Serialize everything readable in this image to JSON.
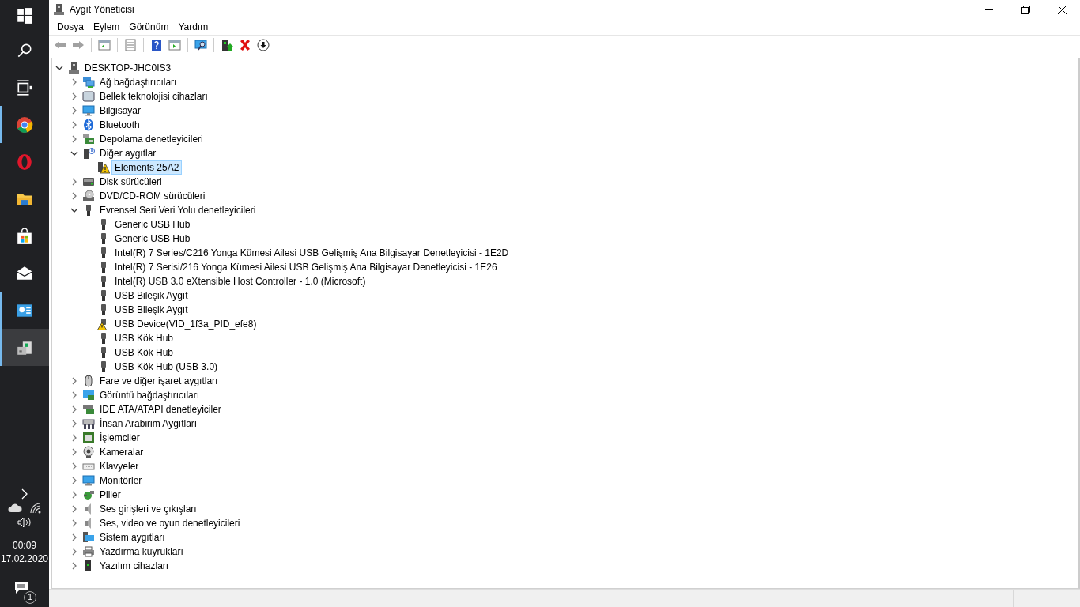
{
  "taskbar": {
    "items": [
      {
        "kind": "start",
        "running": false,
        "active": false
      },
      {
        "kind": "search",
        "running": false,
        "active": false
      },
      {
        "kind": "task-view",
        "running": false,
        "active": false
      },
      {
        "kind": "chrome",
        "running": true,
        "active": false
      },
      {
        "kind": "opera",
        "running": false,
        "active": false
      },
      {
        "kind": "explorer",
        "running": false,
        "active": false
      },
      {
        "kind": "store",
        "running": false,
        "active": false
      },
      {
        "kind": "mail",
        "running": false,
        "active": false
      },
      {
        "kind": "control",
        "running": true,
        "active": false
      },
      {
        "kind": "device-manager",
        "running": true,
        "active": true
      }
    ],
    "clock": {
      "time": "00:09",
      "date": "17.02.2020"
    },
    "notification_count": "1"
  },
  "window": {
    "title": "Aygıt Yöneticisi"
  },
  "menu": [
    "Dosya",
    "Eylem",
    "Görünüm",
    "Yardım"
  ],
  "toolbar": [
    {
      "kind": "back",
      "disabled": true
    },
    {
      "kind": "forward",
      "disabled": true
    },
    {
      "kind": "sep"
    },
    {
      "kind": "console-tree",
      "disabled": false
    },
    {
      "kind": "sep"
    },
    {
      "kind": "properties",
      "disabled": false
    },
    {
      "kind": "sep"
    },
    {
      "kind": "help",
      "disabled": false
    },
    {
      "kind": "action-pane",
      "disabled": false
    },
    {
      "kind": "sep"
    },
    {
      "kind": "scan",
      "disabled": false
    },
    {
      "kind": "sep"
    },
    {
      "kind": "update",
      "disabled": false
    },
    {
      "kind": "uninstall",
      "disabled": false
    },
    {
      "kind": "download",
      "disabled": false
    }
  ],
  "tree": {
    "label": "DESKTOP-JHC0IS3",
    "kind": "pc",
    "expanded": true,
    "selected": false,
    "children": [
      {
        "label": "Ağ bağdaştırıcıları",
        "kind": "network",
        "expanded": false,
        "selected": false
      },
      {
        "label": "Bellek teknolojisi cihazları",
        "kind": "memory",
        "expanded": false,
        "selected": false
      },
      {
        "label": "Bilgisayar",
        "kind": "computer",
        "expanded": false,
        "selected": false
      },
      {
        "label": "Bluetooth",
        "kind": "bluetooth",
        "expanded": false,
        "selected": false
      },
      {
        "label": "Depolama denetleyicileri",
        "kind": "storage",
        "expanded": false,
        "selected": false
      },
      {
        "label": "Diğer aygıtlar",
        "kind": "unknown",
        "expanded": true,
        "selected": false,
        "children": [
          {
            "label": "Elements 25A2",
            "kind": "warning-device",
            "selected": true
          }
        ]
      },
      {
        "label": "Disk sürücüleri",
        "kind": "disk",
        "expanded": false,
        "selected": false
      },
      {
        "label": "DVD/CD-ROM sürücüleri",
        "kind": "dvd",
        "expanded": false,
        "selected": false
      },
      {
        "label": "Evrensel Seri Veri Yolu denetleyicileri",
        "kind": "usb",
        "expanded": true,
        "selected": false,
        "children": [
          {
            "label": "Generic USB Hub",
            "kind": "usb",
            "selected": false
          },
          {
            "label": "Generic USB Hub",
            "kind": "usb",
            "selected": false
          },
          {
            "label": "Intel(R) 7 Series/C216 Yonga Kümesi Ailesi USB Gelişmiş Ana Bilgisayar Denetleyicisi - 1E2D",
            "kind": "usb",
            "selected": false
          },
          {
            "label": "Intel(R) 7 Serisi/216 Yonga Kümesi Ailesi USB Gelişmiş Ana Bilgisayar Denetleyicisi - 1E26",
            "kind": "usb",
            "selected": false
          },
          {
            "label": "Intel(R) USB 3.0 eXtensible Host Controller - 1.0 (Microsoft)",
            "kind": "usb",
            "selected": false
          },
          {
            "label": "USB Bileşik Aygıt",
            "kind": "usb",
            "selected": false
          },
          {
            "label": "USB Bileşik Aygıt",
            "kind": "usb",
            "selected": false
          },
          {
            "label": "USB Device(VID_1f3a_PID_efe8)",
            "kind": "usb-warning",
            "selected": false
          },
          {
            "label": "USB Kök Hub",
            "kind": "usb",
            "selected": false
          },
          {
            "label": "USB Kök Hub",
            "kind": "usb",
            "selected": false
          },
          {
            "label": "USB Kök Hub (USB 3.0)",
            "kind": "usb",
            "selected": false
          }
        ]
      },
      {
        "label": "Fare ve diğer işaret aygıtları",
        "kind": "mouse",
        "expanded": false,
        "selected": false
      },
      {
        "label": "Görüntü bağdaştırıcıları",
        "kind": "display-adapter",
        "expanded": false,
        "selected": false
      },
      {
        "label": "IDE ATA/ATAPI denetleyiciler",
        "kind": "ide",
        "expanded": false,
        "selected": false
      },
      {
        "label": "İnsan Arabirim Aygıtları",
        "kind": "hid",
        "expanded": false,
        "selected": false
      },
      {
        "label": "İşlemciler",
        "kind": "cpu",
        "expanded": false,
        "selected": false
      },
      {
        "label": "Kameralar",
        "kind": "camera",
        "expanded": false,
        "selected": false
      },
      {
        "label": "Klavyeler",
        "kind": "keyboard",
        "expanded": false,
        "selected": false
      },
      {
        "label": "Monitörler",
        "kind": "computer",
        "expanded": false,
        "selected": false
      },
      {
        "label": "Piller",
        "kind": "battery",
        "expanded": false,
        "selected": false
      },
      {
        "label": "Ses girişleri ve çıkışları",
        "kind": "audio",
        "expanded": false,
        "selected": false
      },
      {
        "label": "Ses, video ve oyun denetleyicileri",
        "kind": "audio",
        "expanded": false,
        "selected": false
      },
      {
        "label": "Sistem aygıtları",
        "kind": "system",
        "expanded": false,
        "selected": false
      },
      {
        "label": "Yazdırma kuyrukları",
        "kind": "printer",
        "expanded": false,
        "selected": false
      },
      {
        "label": "Yazılım cihazları",
        "kind": "software",
        "expanded": false,
        "selected": false
      }
    ]
  }
}
